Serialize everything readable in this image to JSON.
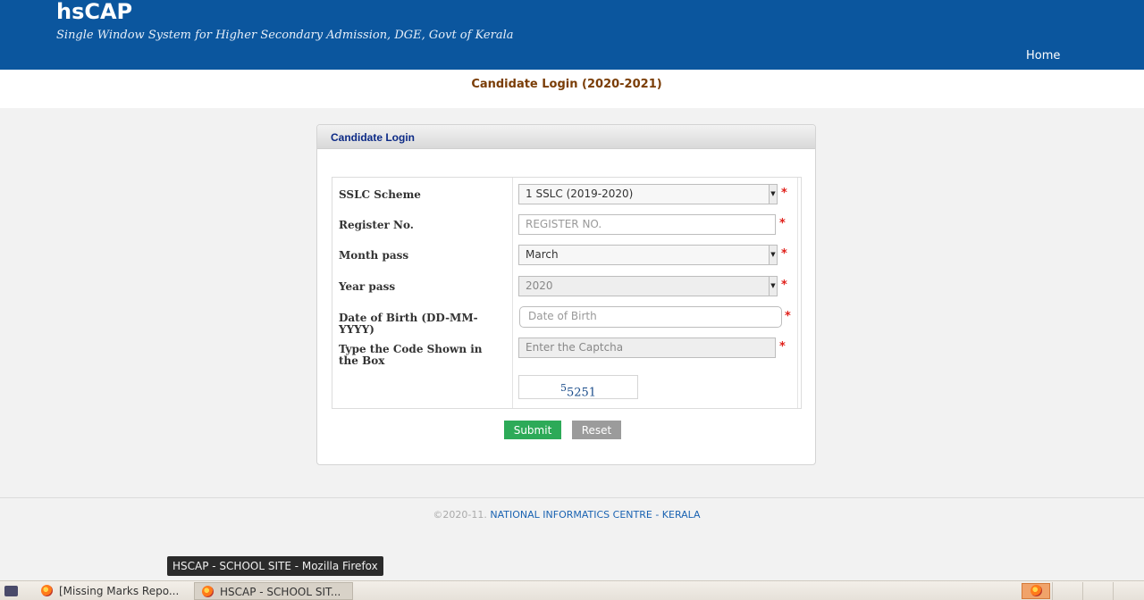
{
  "header": {
    "brand": "hsCAP",
    "tagline": "Single Window System for Higher Secondary Admission, DGE, Govt of Kerala",
    "nav_home": "Home",
    "color": "#0b569e"
  },
  "page_title": "Candidate Login (2020-2021)",
  "panel": {
    "title": "Candidate Login",
    "fields": {
      "sslc_scheme": {
        "label": "SSLC Scheme",
        "value": "1 SSLC (2019-2020)"
      },
      "register_no": {
        "label": "Register No.",
        "placeholder": "REGISTER NO."
      },
      "month_pass": {
        "label": "Month pass",
        "value": "March"
      },
      "year_pass": {
        "label": "Year pass",
        "value": "2020"
      },
      "dob": {
        "label": "Date of Birth (DD-MM-YYYY)",
        "placeholder": "Date of Birth"
      },
      "captcha_input": {
        "label": "Type the Code Shown in the Box",
        "placeholder": "Enter the Captcha"
      }
    },
    "required_mark": "*",
    "captcha": {
      "sup": "5",
      "main": "5251"
    },
    "submit_label": "Submit",
    "reset_label": "Reset"
  },
  "footer": {
    "copyright": "©2020-11. ",
    "org": "NATIONAL INFORMATICS CENTRE - KERALA"
  },
  "tooltip": "HSCAP - SCHOOL SITE - Mozilla Firefox",
  "taskbar": {
    "tasks": [
      {
        "label": "[Missing Marks Repo..."
      },
      {
        "label": "HSCAP - SCHOOL SIT..."
      }
    ]
  }
}
